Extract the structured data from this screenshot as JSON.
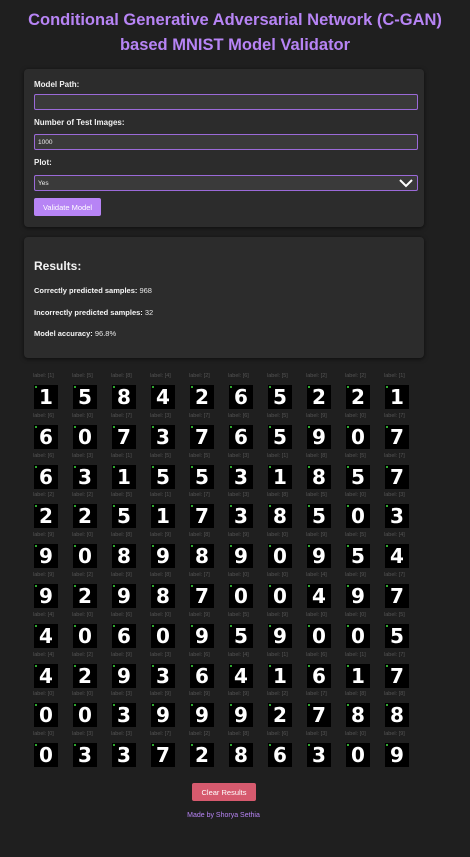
{
  "title": "Conditional Generative Adversarial Network (C-GAN) based MNIST Model Validator",
  "form": {
    "model_path_label": "Model Path:",
    "model_path_value": "",
    "num_images_label": "Number of Test Images:",
    "num_images_value": "1000",
    "plot_label": "Plot:",
    "plot_value": "Yes",
    "validate_button": "Validate Model"
  },
  "results": {
    "heading": "Results:",
    "correct_label": "Correctly predicted samples:",
    "correct_value": "968",
    "incorrect_label": "Incorrectly predicted samples:",
    "incorrect_value": "32",
    "accuracy_label": "Model accuracy:",
    "accuracy_value": "96.8%"
  },
  "samples": [
    {
      "label": "label: [1]",
      "digit": "1"
    },
    {
      "label": "label: [5]",
      "digit": "5"
    },
    {
      "label": "label: [8]",
      "digit": "8"
    },
    {
      "label": "label: [4]",
      "digit": "4"
    },
    {
      "label": "label: [2]",
      "digit": "2"
    },
    {
      "label": "label: [6]",
      "digit": "6"
    },
    {
      "label": "label: [5]",
      "digit": "5"
    },
    {
      "label": "label: [2]",
      "digit": "2"
    },
    {
      "label": "label: [2]",
      "digit": "2"
    },
    {
      "label": "label: [1]",
      "digit": "1"
    },
    {
      "label": "label: [6]",
      "digit": "6"
    },
    {
      "label": "label: [0]",
      "digit": "0"
    },
    {
      "label": "label: [7]",
      "digit": "7"
    },
    {
      "label": "label: [3]",
      "digit": "3"
    },
    {
      "label": "label: [7]",
      "digit": "7"
    },
    {
      "label": "label: [6]",
      "digit": "6"
    },
    {
      "label": "label: [5]",
      "digit": "5"
    },
    {
      "label": "label: [9]",
      "digit": "9"
    },
    {
      "label": "label: [0]",
      "digit": "0"
    },
    {
      "label": "label: [7]",
      "digit": "7"
    },
    {
      "label": "label: [6]",
      "digit": "6"
    },
    {
      "label": "label: [3]",
      "digit": "3"
    },
    {
      "label": "label: [1]",
      "digit": "1"
    },
    {
      "label": "label: [5]",
      "digit": "5"
    },
    {
      "label": "label: [5]",
      "digit": "5"
    },
    {
      "label": "label: [3]",
      "digit": "3"
    },
    {
      "label": "label: [1]",
      "digit": "1"
    },
    {
      "label": "label: [8]",
      "digit": "8"
    },
    {
      "label": "label: [5]",
      "digit": "5"
    },
    {
      "label": "label: [7]",
      "digit": "7"
    },
    {
      "label": "label: [2]",
      "digit": "2"
    },
    {
      "label": "label: [2]",
      "digit": "2"
    },
    {
      "label": "label: [5]",
      "digit": "5"
    },
    {
      "label": "label: [1]",
      "digit": "1"
    },
    {
      "label": "label: [7]",
      "digit": "7"
    },
    {
      "label": "label: [3]",
      "digit": "3"
    },
    {
      "label": "label: [8]",
      "digit": "8"
    },
    {
      "label": "label: [5]",
      "digit": "5"
    },
    {
      "label": "label: [0]",
      "digit": "0"
    },
    {
      "label": "label: [3]",
      "digit": "3"
    },
    {
      "label": "label: [9]",
      "digit": "9"
    },
    {
      "label": "label: [0]",
      "digit": "0"
    },
    {
      "label": "label: [8]",
      "digit": "8"
    },
    {
      "label": "label: [9]",
      "digit": "9"
    },
    {
      "label": "label: [8]",
      "digit": "8"
    },
    {
      "label": "label: [9]",
      "digit": "9"
    },
    {
      "label": "label: [0]",
      "digit": "0"
    },
    {
      "label": "label: [9]",
      "digit": "9"
    },
    {
      "label": "label: [5]",
      "digit": "5"
    },
    {
      "label": "label: [4]",
      "digit": "4"
    },
    {
      "label": "label: [9]",
      "digit": "9"
    },
    {
      "label": "label: [2]",
      "digit": "2"
    },
    {
      "label": "label: [9]",
      "digit": "9"
    },
    {
      "label": "label: [8]",
      "digit": "8"
    },
    {
      "label": "label: [7]",
      "digit": "7"
    },
    {
      "label": "label: [0]",
      "digit": "0"
    },
    {
      "label": "label: [0]",
      "digit": "0"
    },
    {
      "label": "label: [4]",
      "digit": "4"
    },
    {
      "label": "label: [9]",
      "digit": "9"
    },
    {
      "label": "label: [7]",
      "digit": "7"
    },
    {
      "label": "label: [4]",
      "digit": "4"
    },
    {
      "label": "label: [0]",
      "digit": "0"
    },
    {
      "label": "label: [6]",
      "digit": "6"
    },
    {
      "label": "label: [0]",
      "digit": "0"
    },
    {
      "label": "label: [9]",
      "digit": "9"
    },
    {
      "label": "label: [5]",
      "digit": "5"
    },
    {
      "label": "label: [9]",
      "digit": "9"
    },
    {
      "label": "label: [0]",
      "digit": "0"
    },
    {
      "label": "label: [0]",
      "digit": "0"
    },
    {
      "label": "label: [5]",
      "digit": "5"
    },
    {
      "label": "label: [4]",
      "digit": "4"
    },
    {
      "label": "label: [2]",
      "digit": "2"
    },
    {
      "label": "label: [9]",
      "digit": "9"
    },
    {
      "label": "label: [3]",
      "digit": "3"
    },
    {
      "label": "label: [6]",
      "digit": "6"
    },
    {
      "label": "label: [4]",
      "digit": "4"
    },
    {
      "label": "label: [1]",
      "digit": "1"
    },
    {
      "label": "label: [6]",
      "digit": "6"
    },
    {
      "label": "label: [1]",
      "digit": "1"
    },
    {
      "label": "label: [7]",
      "digit": "7"
    },
    {
      "label": "label: [0]",
      "digit": "0"
    },
    {
      "label": "label: [0]",
      "digit": "0"
    },
    {
      "label": "label: [3]",
      "digit": "3"
    },
    {
      "label": "label: [9]",
      "digit": "9"
    },
    {
      "label": "label: [9]",
      "digit": "9"
    },
    {
      "label": "label: [9]",
      "digit": "9"
    },
    {
      "label": "label: [2]",
      "digit": "2"
    },
    {
      "label": "label: [7]",
      "digit": "7"
    },
    {
      "label": "label: [8]",
      "digit": "8"
    },
    {
      "label": "label: [8]",
      "digit": "8"
    },
    {
      "label": "label: [0]",
      "digit": "0"
    },
    {
      "label": "label: [3]",
      "digit": "3"
    },
    {
      "label": "label: [3]",
      "digit": "3"
    },
    {
      "label": "label: [7]",
      "digit": "7"
    },
    {
      "label": "label: [2]",
      "digit": "2"
    },
    {
      "label": "label: [8]",
      "digit": "8"
    },
    {
      "label": "label: [6]",
      "digit": "6"
    },
    {
      "label": "label: [3]",
      "digit": "3"
    },
    {
      "label": "label: [0]",
      "digit": "0"
    },
    {
      "label": "label: [9]",
      "digit": "9"
    }
  ],
  "clear_button": "Clear Results",
  "footer": "Made by Shorya Sethia",
  "colors": {
    "background": "#1f1f1f",
    "card": "#2c2c2c",
    "accent": "#b784f5",
    "clear": "#d65a6e"
  }
}
